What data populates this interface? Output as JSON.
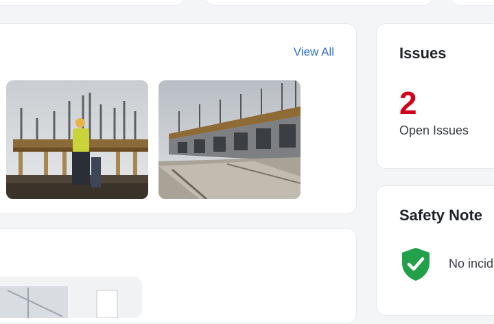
{
  "photos": {
    "view_all_label": "View All",
    "items": [
      {
        "icon": "construction-photo-worker"
      },
      {
        "icon": "construction-photo-structure"
      }
    ]
  },
  "issues": {
    "title": "Issues",
    "count": "2",
    "count_color": "#d0021b",
    "label": "Open Issues"
  },
  "safety": {
    "title": "Safety Note",
    "icon": "shield-check-icon",
    "icon_color": "#22a04a",
    "text": "No incid"
  },
  "colors": {
    "link": "#2f6fd0",
    "background": "#f4f5f7",
    "card": "#ffffff"
  }
}
